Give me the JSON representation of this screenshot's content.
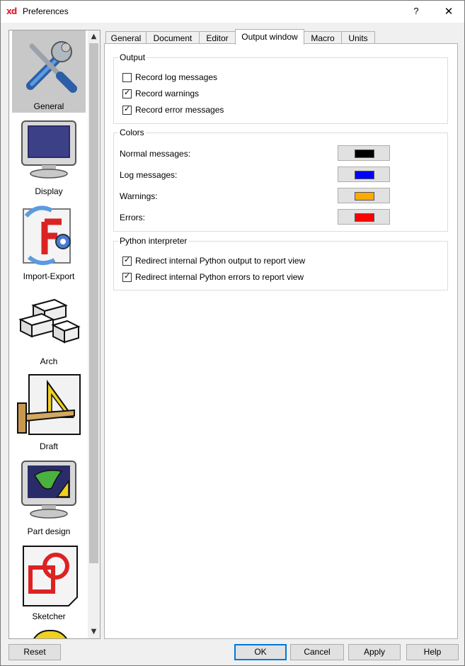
{
  "window": {
    "title": "Preferences",
    "app_icon": "xd",
    "help_glyph": "?",
    "close_glyph": "✕"
  },
  "sidebar": {
    "items": [
      {
        "label": "General",
        "icon": "tools-icon",
        "selected": true
      },
      {
        "label": "Display",
        "icon": "monitor-icon",
        "selected": false
      },
      {
        "label": "Import-Export",
        "icon": "import-export-icon",
        "selected": false
      },
      {
        "label": "Arch",
        "icon": "bricks-icon",
        "selected": false
      },
      {
        "label": "Draft",
        "icon": "draft-ruler-icon",
        "selected": false
      },
      {
        "label": "Part design",
        "icon": "part-design-icon",
        "selected": false
      },
      {
        "label": "Sketcher",
        "icon": "sketcher-icon",
        "selected": false
      }
    ],
    "scroll_up": "▲",
    "scroll_down": "▼"
  },
  "tabs": [
    {
      "label": "General",
      "active": false
    },
    {
      "label": "Document",
      "active": false
    },
    {
      "label": "Editor",
      "active": false
    },
    {
      "label": "Output window",
      "active": true
    },
    {
      "label": "Macro",
      "active": false
    },
    {
      "label": "Units",
      "active": false
    }
  ],
  "output_group": {
    "title": "Output",
    "options": [
      {
        "label": "Record log messages",
        "checked": false
      },
      {
        "label": "Record warnings",
        "checked": true
      },
      {
        "label": "Record error messages",
        "checked": true
      }
    ]
  },
  "colors_group": {
    "title": "Colors",
    "rows": [
      {
        "label": "Normal messages:",
        "color": "#000000"
      },
      {
        "label": "Log messages:",
        "color": "#0000ff"
      },
      {
        "label": "Warnings:",
        "color": "#ffaa00"
      },
      {
        "label": "Errors:",
        "color": "#ff0000"
      }
    ]
  },
  "python_group": {
    "title": "Python interpreter",
    "options": [
      {
        "label": "Redirect internal Python output to report view",
        "checked": true
      },
      {
        "label": "Redirect internal Python errors to report view",
        "checked": true
      }
    ]
  },
  "buttons": {
    "reset": "Reset",
    "ok": "OK",
    "cancel": "Cancel",
    "apply": "Apply",
    "help": "Help"
  },
  "check_glyph": "✓"
}
